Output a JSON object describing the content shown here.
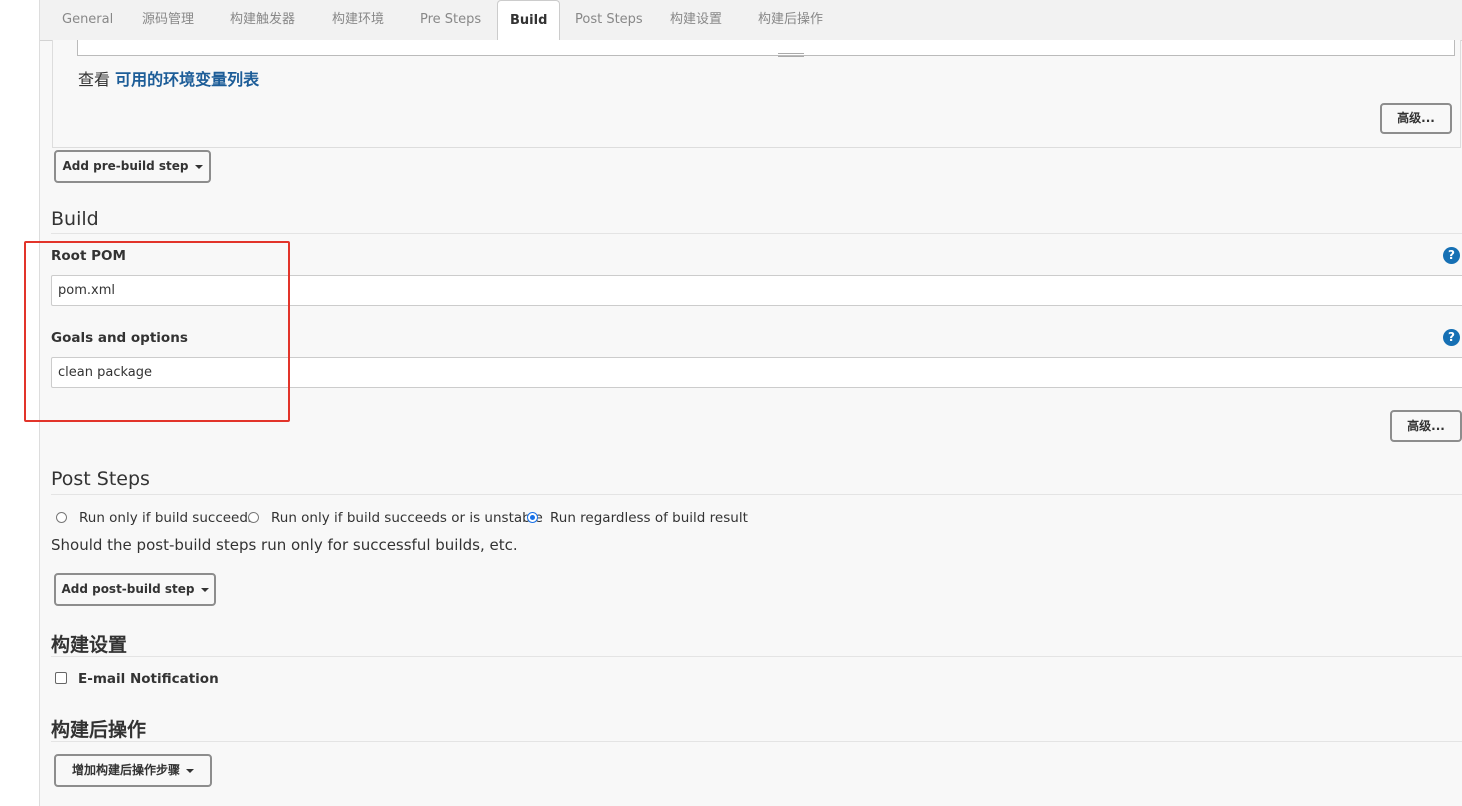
{
  "tabs": [
    {
      "label": "General"
    },
    {
      "label": "源码管理"
    },
    {
      "label": "构建触发器"
    },
    {
      "label": "构建环境"
    },
    {
      "label": "Pre Steps"
    },
    {
      "label": "Build",
      "active": true
    },
    {
      "label": "Post Steps"
    },
    {
      "label": "构建设置"
    },
    {
      "label": "构建后操作"
    }
  ],
  "pre_steps": {
    "env_prefix": "查看",
    "env_link": "可用的环境变量列表",
    "advanced_label": "高级...",
    "add_step_label": "Add pre-build step"
  },
  "build": {
    "title": "Build",
    "root_pom_label": "Root POM",
    "root_pom_value": "pom.xml",
    "goals_label": "Goals and options",
    "goals_value": "clean package",
    "advanced_label": "高级...",
    "help_glyph": "?"
  },
  "post_steps": {
    "title": "Post Steps",
    "options": [
      {
        "label": "Run only if build succeeds",
        "checked": false
      },
      {
        "label": "Run only if build succeeds or is unstable",
        "checked": false
      },
      {
        "label": "Run regardless of build result",
        "checked": true
      }
    ],
    "helper_text": "Should the post-build steps run only for successful builds, etc.",
    "add_step_label": "Add post-build step"
  },
  "build_settings": {
    "title": "构建设置",
    "email_label": "E-mail Notification",
    "email_checked": false
  },
  "post_build": {
    "title": "构建后操作",
    "add_step_label": "增加构建后操作步骤"
  },
  "colors": {
    "link": "#1d5d98",
    "help_icon": "#1670b4",
    "highlight_box": "#e2342a"
  }
}
